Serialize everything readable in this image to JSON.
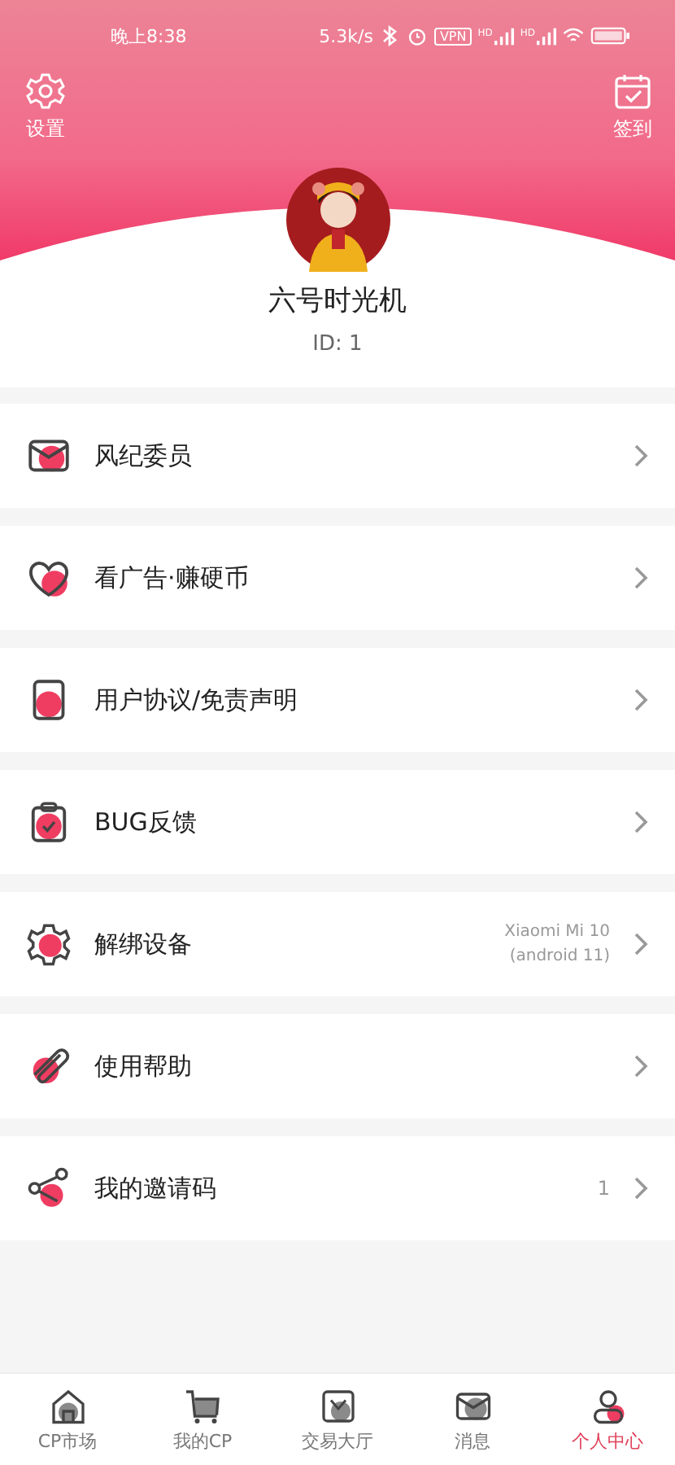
{
  "status_bar": {
    "time": "晚上8:38",
    "speed": "5.3k/s",
    "vpn": "VPN",
    "signal_labels": [
      "HD",
      "HD"
    ]
  },
  "header": {
    "left_action": {
      "label": "设置"
    },
    "right_action": {
      "label": "签到"
    }
  },
  "profile": {
    "name": "六号时光机",
    "id": "ID: 1"
  },
  "menu": [
    {
      "label": "风纪委员"
    },
    {
      "label": "看广告·赚硬币"
    },
    {
      "label": "用户协议/免责声明"
    },
    {
      "label": "BUG反馈"
    },
    {
      "label": "解绑设备",
      "detail": [
        "Xiaomi Mi 10",
        "(android 11)"
      ]
    },
    {
      "label": "使用帮助"
    },
    {
      "label": "我的邀请码",
      "value": "1"
    }
  ],
  "tabs": [
    {
      "label": "CP市场",
      "selected": false
    },
    {
      "label": "我的CP",
      "selected": false
    },
    {
      "label": "交易大厅",
      "selected": false
    },
    {
      "label": "消息",
      "selected": false
    },
    {
      "label": "个人中心",
      "selected": true
    }
  ]
}
